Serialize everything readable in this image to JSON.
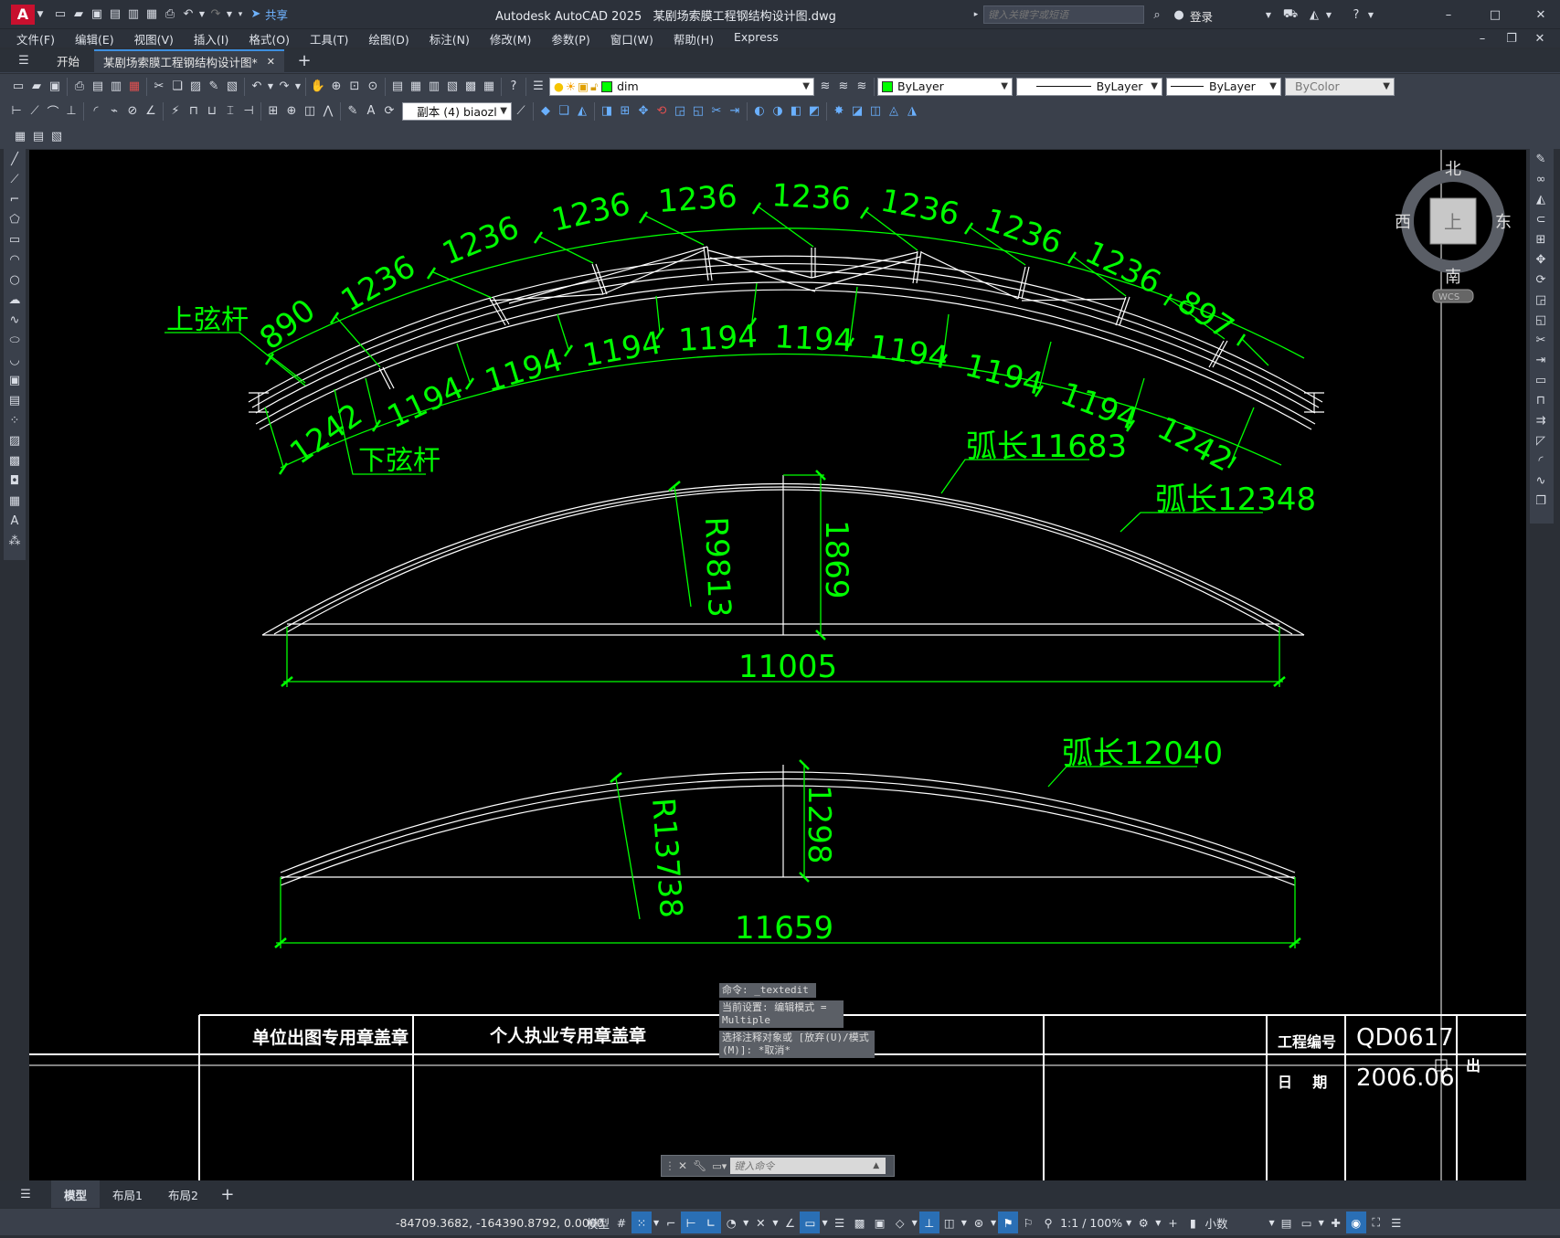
{
  "title": {
    "app_name": "Autodesk AutoCAD 2025",
    "file_name": "某剧场索膜工程钢结构设计图.dwg",
    "search_placeholder": "键入关键字或短语",
    "share": "共享",
    "login": "登录"
  },
  "menu": [
    "文件(F)",
    "编辑(E)",
    "视图(V)",
    "插入(I)",
    "格式(O)",
    "工具(T)",
    "绘图(D)",
    "标注(N)",
    "修改(M)",
    "参数(P)",
    "窗口(W)",
    "帮助(H)",
    "Express"
  ],
  "doc_tabs": {
    "start": "开始",
    "active": "某剧场索膜工程钢结构设计图*"
  },
  "toolbar": {
    "layer": "dim",
    "color": "ByLayer",
    "linetype": "ByLayer",
    "lineweight": "ByLayer",
    "plotstyle": "ByColor",
    "dimstyle": "副本 (4) biaozl"
  },
  "viewcube": {
    "north": "北",
    "south": "南",
    "east": "东",
    "west": "西",
    "top": "上",
    "wcs": "WCS"
  },
  "drawing": {
    "truss": {
      "top_segments": [
        "890",
        "1236",
        "1236",
        "1236",
        "1236",
        "1236",
        "1236",
        "1236",
        "1236",
        "897"
      ],
      "bottom_segments": [
        "1242",
        "1194",
        "1194",
        "1194",
        "1194",
        "1194",
        "1194",
        "1194",
        "1194",
        "1242"
      ],
      "label_top_chord": "上弦杆",
      "label_bottom_chord": "下弦杆"
    },
    "arch1": {
      "arc_top": "弧长11683",
      "arc_bottom": "弧长12348",
      "radius": "R9813",
      "rise": "1869",
      "span": "11005"
    },
    "arch2": {
      "arc": "弧长12040",
      "radius": "R13738",
      "rise": "1298",
      "span": "11659"
    },
    "title_block": {
      "stamp1": "单位出图专用章盖章",
      "stamp2": "个人执业专用章盖章",
      "project_no_label": "工程编号",
      "project_no": "QD0617",
      "date_label": "日    期",
      "date": "2006.06",
      "extra": "出"
    }
  },
  "command": {
    "history": [
      "命令: _textedit",
      "当前设置: 编辑模式 = Multiple",
      "选择注释对象或 [放弃(U)/模式(M)]: *取消*"
    ],
    "placeholder": "键入命令"
  },
  "layout_tabs": [
    "模型",
    "布局1",
    "布局2"
  ],
  "status": {
    "coords": "-84709.3682, -164390.8792, 0.0000",
    "model": "模型",
    "scale": "1:1 / 100%",
    "units": "小数"
  }
}
